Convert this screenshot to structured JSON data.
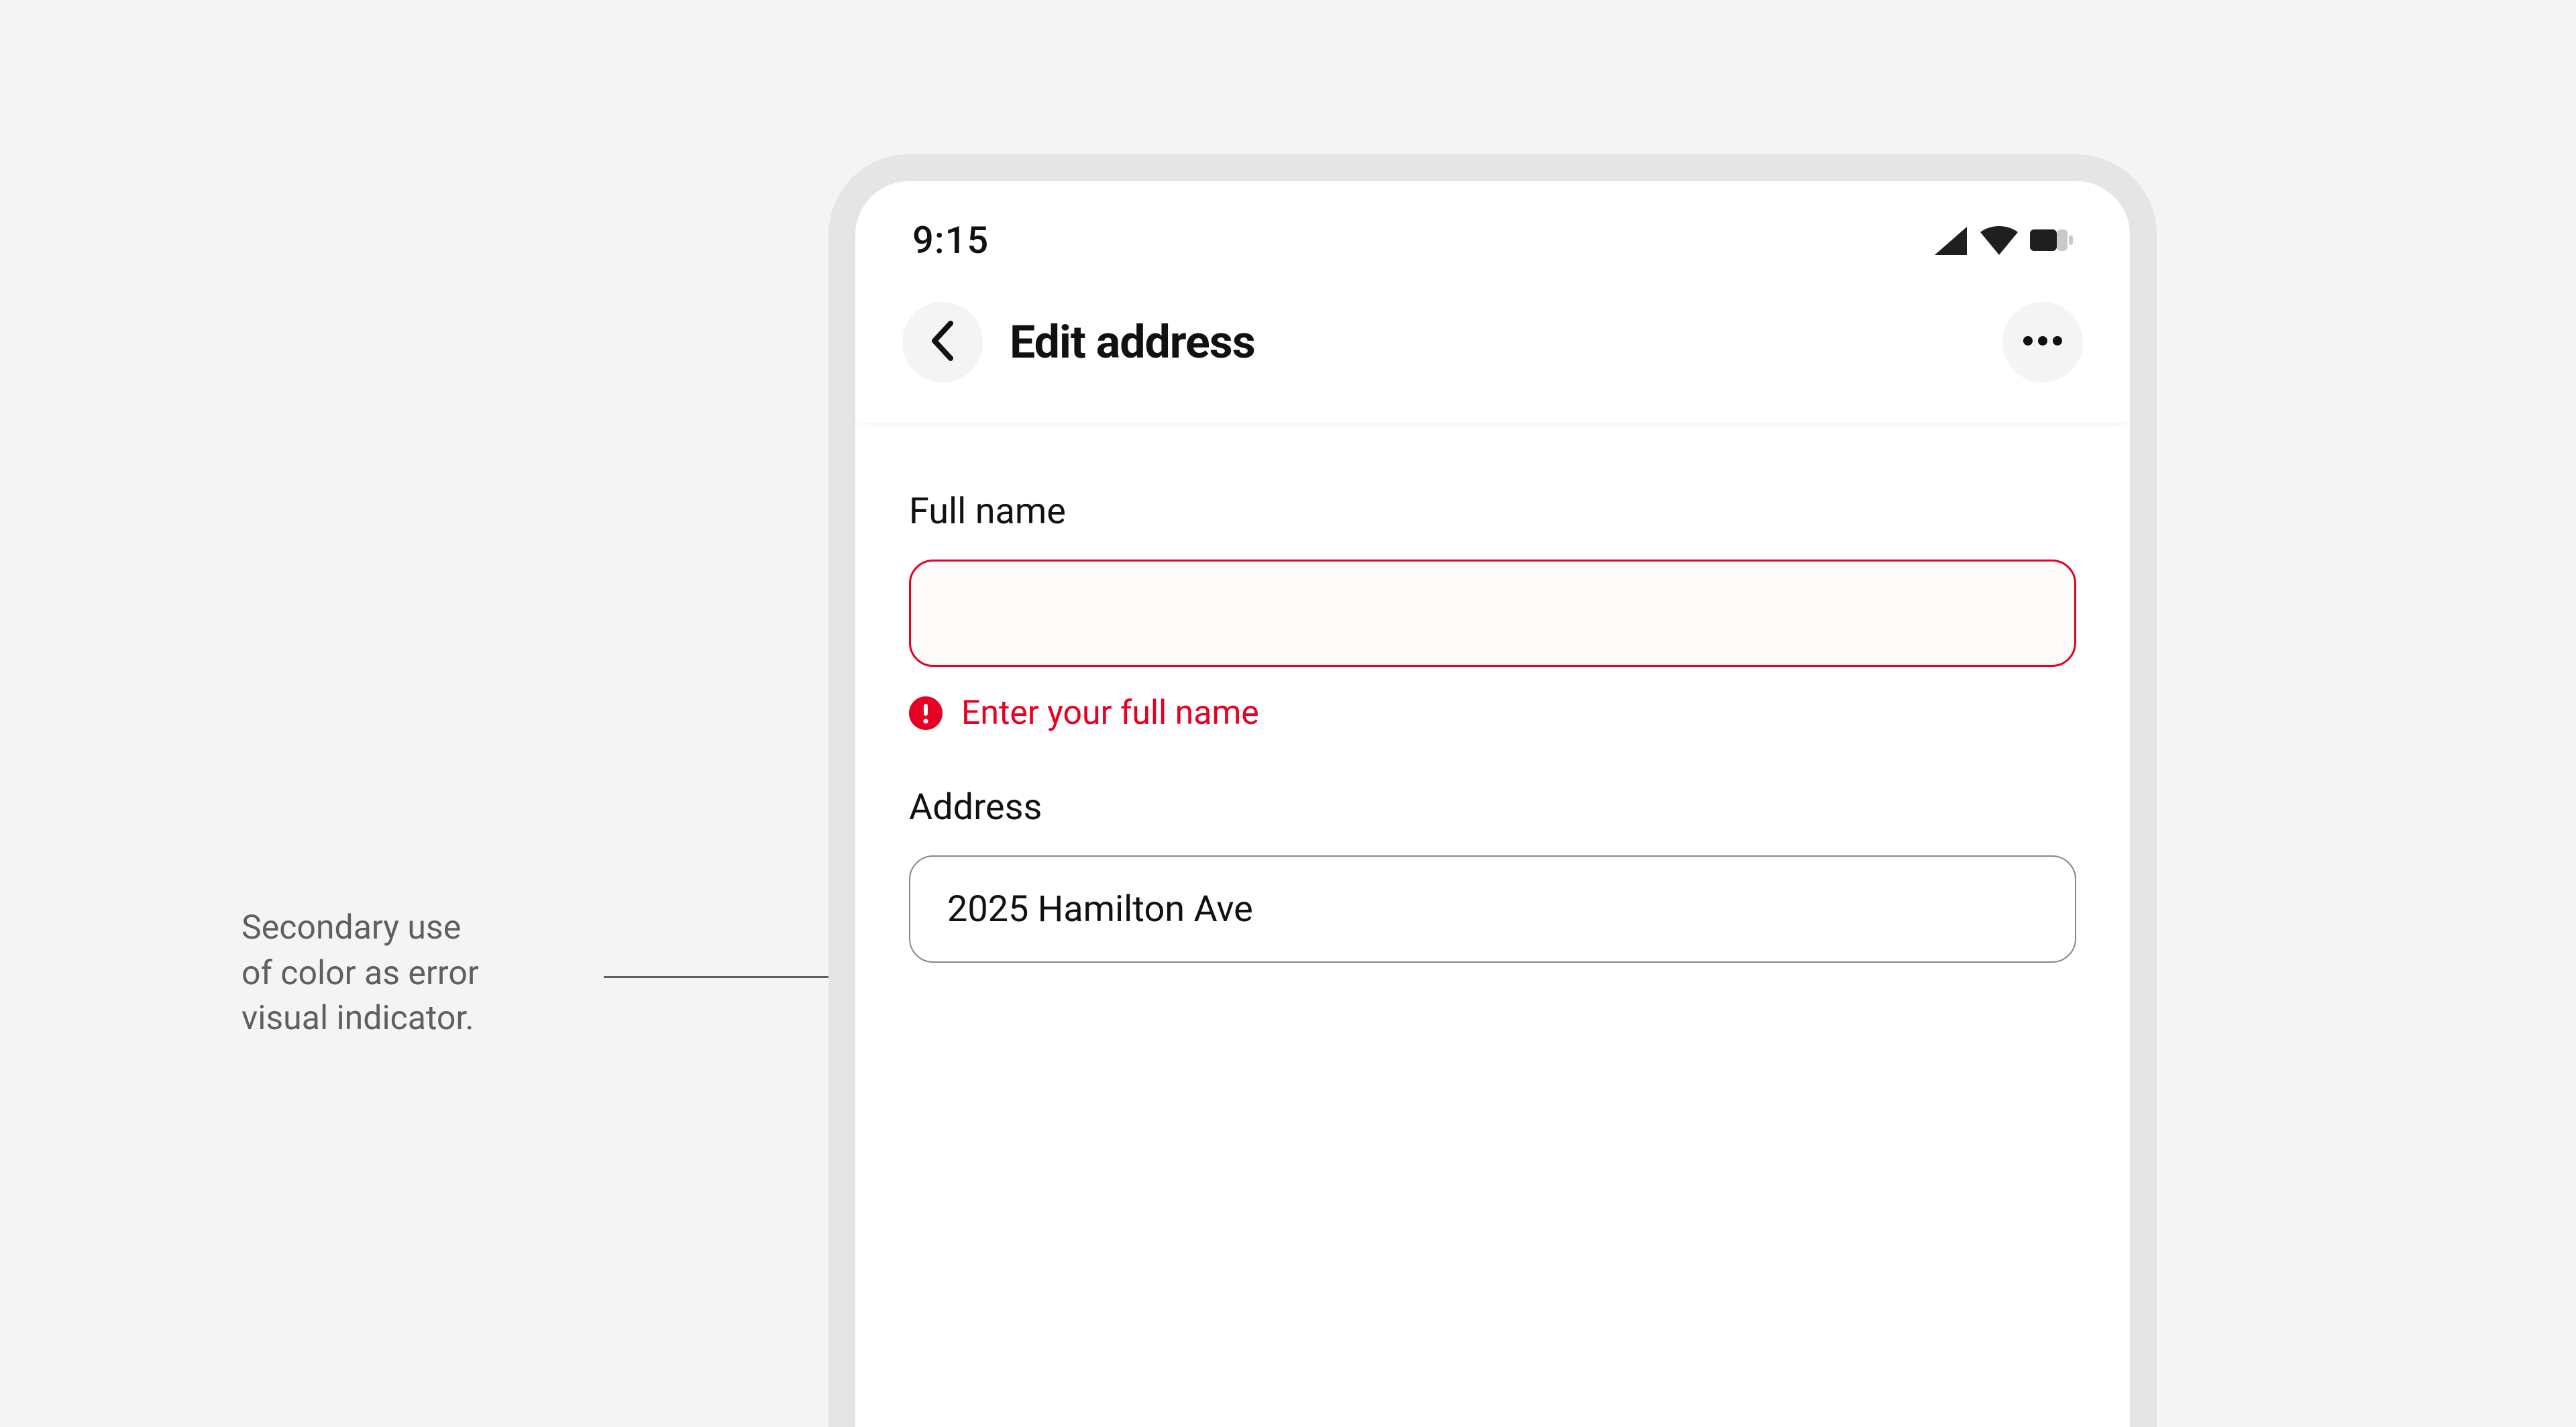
{
  "annotation": {
    "line1": "Secondary use",
    "line2": "of color as error",
    "line3": "visual indicator."
  },
  "status": {
    "time": "9:15"
  },
  "appbar": {
    "title": "Edit address"
  },
  "form": {
    "full_name": {
      "label": "Full name",
      "value": "",
      "error": "Enter your full name"
    },
    "address": {
      "label": "Address",
      "value": "2025 Hamilton Ave"
    }
  },
  "colors": {
    "error": "#e60023",
    "text": "#111111",
    "muted": "#5f5f5f",
    "frame": "#e5e5e5",
    "bg": "#f4f4f4"
  }
}
